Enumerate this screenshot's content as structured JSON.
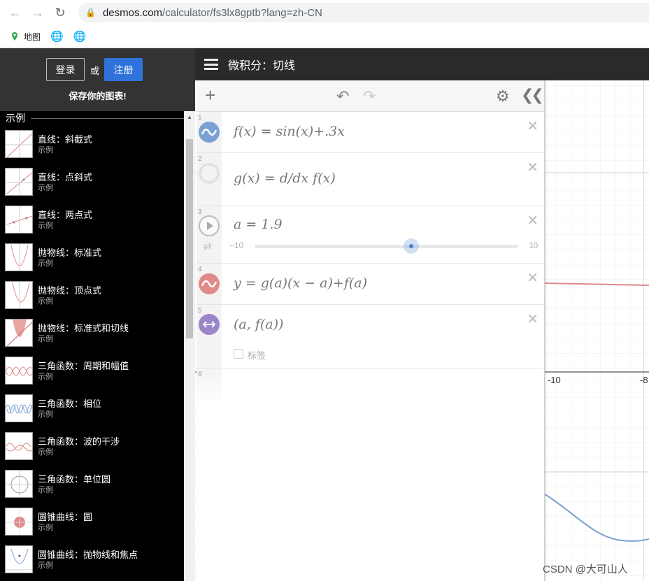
{
  "browser": {
    "url_host": "desmos.com",
    "url_path": "/calculator/fs3lx8gptb?lang=zh-CN",
    "bookmarks": [
      "地图"
    ]
  },
  "auth": {
    "login_label": "登录",
    "or_label": "或",
    "signup_label": "注册",
    "save_prompt": "保存你的图表!"
  },
  "examples": {
    "section_title": "示例",
    "items": [
      {
        "title": "直线：斜截式",
        "sub": "示例"
      },
      {
        "title": "直线：点斜式",
        "sub": "示例"
      },
      {
        "title": "直线：两点式",
        "sub": "示例"
      },
      {
        "title": "抛物线：标准式",
        "sub": "示例"
      },
      {
        "title": "抛物线：顶点式",
        "sub": "示例"
      },
      {
        "title": "抛物线：标准式和切线",
        "sub": "示例"
      },
      {
        "title": "三角函数：周期和幅值",
        "sub": "示例"
      },
      {
        "title": "三角函数：相位",
        "sub": "示例"
      },
      {
        "title": "三角函数：波的干涉",
        "sub": "示例"
      },
      {
        "title": "三角函数：单位圆",
        "sub": "示例"
      },
      {
        "title": "圆锥曲线：圆",
        "sub": "示例"
      },
      {
        "title": "圆锥曲线：抛物线和焦点",
        "sub": "示例"
      }
    ]
  },
  "graph": {
    "title": "微积分：切线",
    "x_tick_labels": [
      "-10",
      "-8"
    ]
  },
  "expressions": [
    {
      "num": "1",
      "latex": "f(x) = sin(x)+.3x",
      "color": "#7aa0d4"
    },
    {
      "num": "2",
      "latex": "g(x) = d/dx f(x)",
      "color": "#dddddd"
    },
    {
      "num": "3",
      "latex": "a = 1.9",
      "slider_min": "−10",
      "slider_max": "10",
      "slider_value": 1.9
    },
    {
      "num": "4",
      "latex": "y = g(a)(x − a)+f(a)",
      "color": "#e08a8a"
    },
    {
      "num": "5",
      "latex": "(a, f(a))",
      "color": "#9b86c8",
      "label_text": "标签"
    },
    {
      "num": "6"
    }
  ],
  "watermark": "CSDN @大可山人"
}
